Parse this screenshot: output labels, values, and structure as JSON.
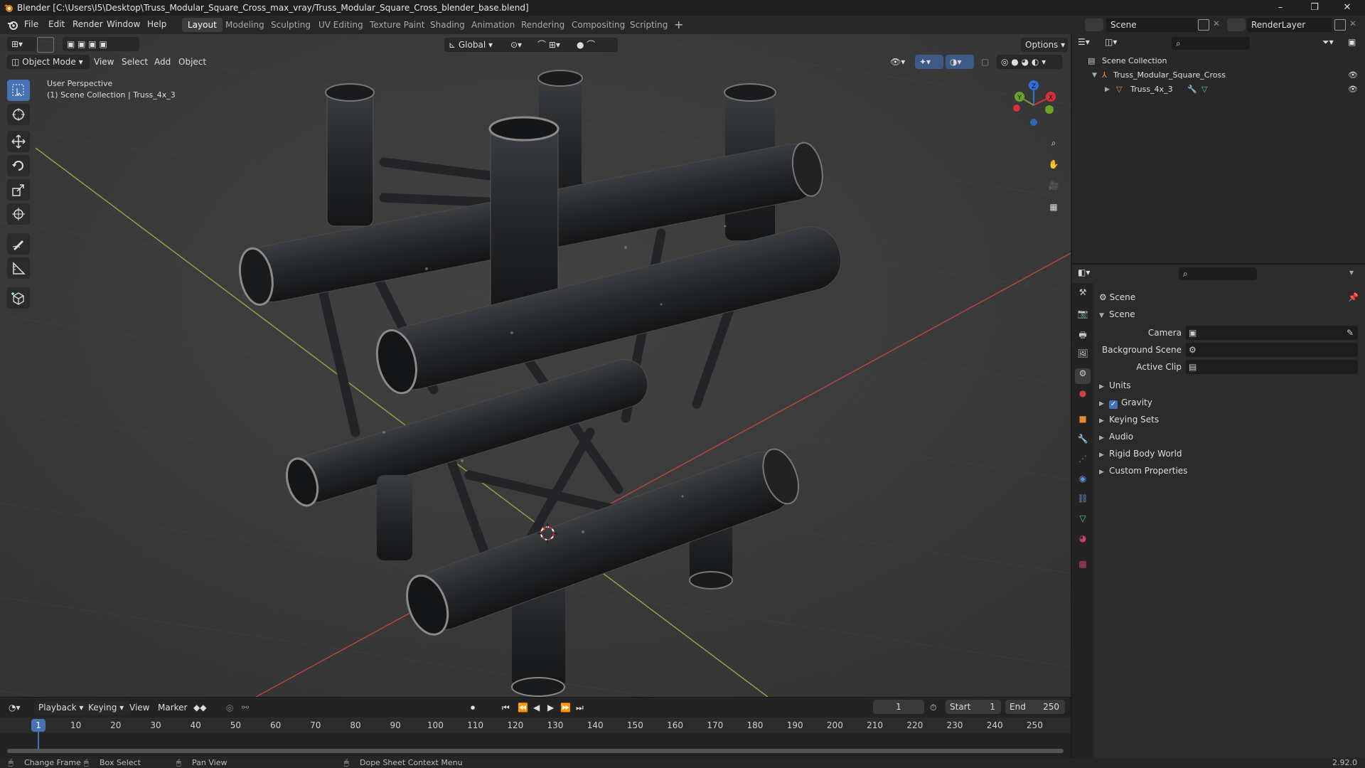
{
  "window": {
    "title": "Blender [C:\\Users\\I5\\Desktop\\Truss_Modular_Square_Cross_max_vray/Truss_Modular_Square_Cross_blender_base.blend]",
    "controls": [
      "–",
      "❐",
      "✕"
    ]
  },
  "menu": {
    "items": [
      "File",
      "Edit",
      "Render",
      "Window",
      "Help"
    ]
  },
  "workspaces": {
    "tabs": [
      "Layout",
      "Modeling",
      "Sculpting",
      "UV Editing",
      "Texture Paint",
      "Shading",
      "Animation",
      "Rendering",
      "Compositing",
      "Scripting"
    ],
    "active": "Layout",
    "add_label": "+"
  },
  "scene_selector": {
    "value": "Scene"
  },
  "renderlayer_selector": {
    "value": "RenderLayer"
  },
  "viewport": {
    "mode": "Object Mode",
    "menus": [
      "View",
      "Select",
      "Add",
      "Object"
    ],
    "transform_orientation": "Global",
    "options_label": "Options",
    "overlay_text_line1": "User Perspective",
    "overlay_text_line2": "(1) Scene Collection | Truss_4x_3",
    "gizmo": {
      "x": "X",
      "y": "Y",
      "z": "Z"
    }
  },
  "outliner": {
    "root": "Scene Collection",
    "items": [
      {
        "name": "Truss_Modular_Square_Cross",
        "type": "collection"
      },
      {
        "name": "Truss_4x_3",
        "type": "object"
      }
    ]
  },
  "properties": {
    "header": "Scene",
    "panel_title": "Scene",
    "fields": [
      {
        "label": "Camera",
        "value": ""
      },
      {
        "label": "Background Scene",
        "value": ""
      },
      {
        "label": "Active Clip",
        "value": ""
      }
    ],
    "subpanels": [
      "Units",
      "Gravity",
      "Keying Sets",
      "Audio",
      "Rigid Body World",
      "Custom Properties"
    ],
    "gravity_checked": true
  },
  "timeline": {
    "menus": [
      "Playback",
      "Keying",
      "View",
      "Marker"
    ],
    "current_frame": "1",
    "start_label": "Start",
    "start_value": "1",
    "end_label": "End",
    "end_value": "250",
    "ticks": [
      "1",
      "10",
      "20",
      "30",
      "40",
      "50",
      "60",
      "70",
      "80",
      "90",
      "100",
      "110",
      "120",
      "130",
      "140",
      "150",
      "160",
      "170",
      "180",
      "190",
      "200",
      "210",
      "220",
      "230",
      "240",
      "250"
    ]
  },
  "statusbar": {
    "items": [
      "Change Frame",
      "Box Select",
      "Pan View",
      "Dope Sheet Context Menu"
    ],
    "version": "2.92.0"
  }
}
